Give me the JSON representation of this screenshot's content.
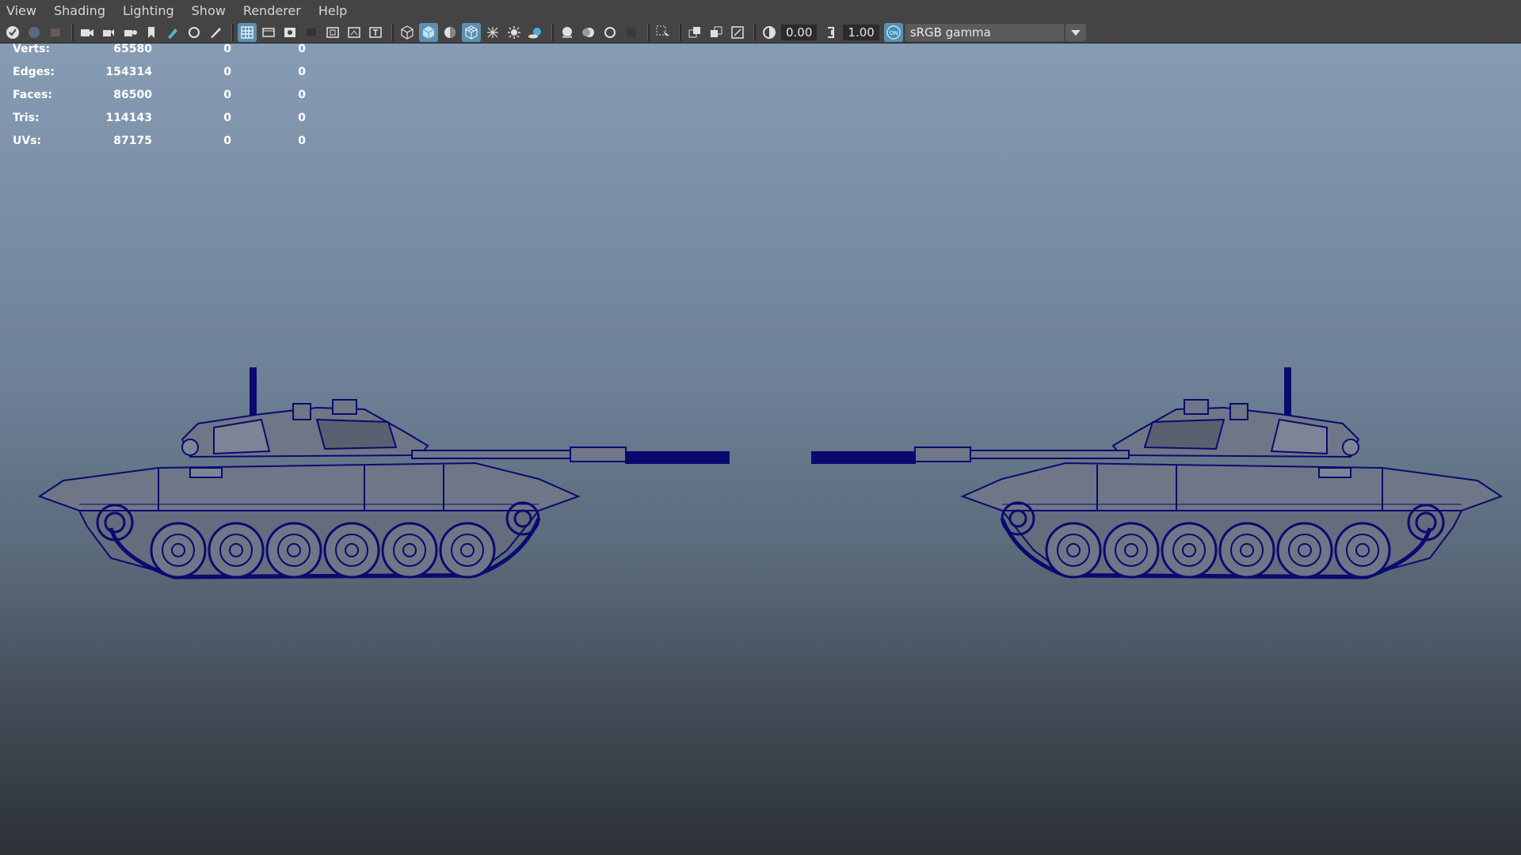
{
  "menu": [
    "View",
    "Shading",
    "Lighting",
    "Show",
    "Renderer",
    "Help"
  ],
  "toolbar": {
    "exposure_value": "0.00",
    "gamma_value": "1.00",
    "color_space": "sRGB gamma"
  },
  "hud": {
    "rows": [
      {
        "label": "Verts:",
        "value": "65580",
        "selected": "0",
        "component": "0"
      },
      {
        "label": "Edges:",
        "value": "154314",
        "selected": "0",
        "component": "0"
      },
      {
        "label": "Faces:",
        "value": "86500",
        "selected": "0",
        "component": "0"
      },
      {
        "label": "Tris:",
        "value": "114143",
        "selected": "0",
        "component": "0"
      },
      {
        "label": "UVs:",
        "value": "87175",
        "selected": "0",
        "component": "0"
      }
    ]
  },
  "colors": {
    "wireframe": "#0a0a6e",
    "toolbar_bg": "#444444",
    "active_button": "#5d8fb0"
  }
}
